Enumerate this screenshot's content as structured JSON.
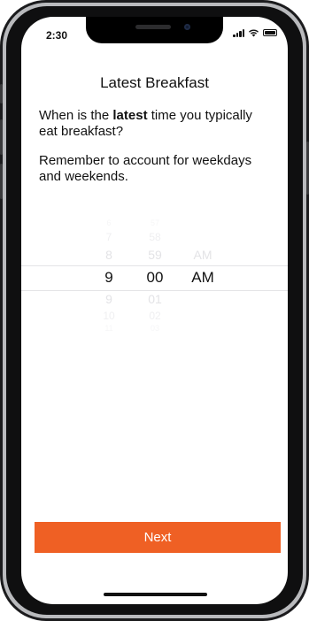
{
  "status_bar": {
    "time": "2:30"
  },
  "page": {
    "title": "Latest Breakfast",
    "question_prefix": "When is the ",
    "question_bold": "latest",
    "question_suffix": " time you typically eat breakfast?",
    "reminder": "Remember to account for weekdays and weekends."
  },
  "picker": {
    "hours": [
      "6",
      "7",
      "8",
      "9",
      "9",
      "10",
      "11"
    ],
    "minutes": [
      "57",
      "58",
      "59",
      "00",
      "01",
      "02",
      "03"
    ],
    "periods": [
      "AM",
      "AM"
    ],
    "selected": {
      "hour": "9",
      "minute": "00",
      "period": "AM"
    }
  },
  "next_button": {
    "label": "Next"
  },
  "colors": {
    "accent": "#ef6024"
  }
}
